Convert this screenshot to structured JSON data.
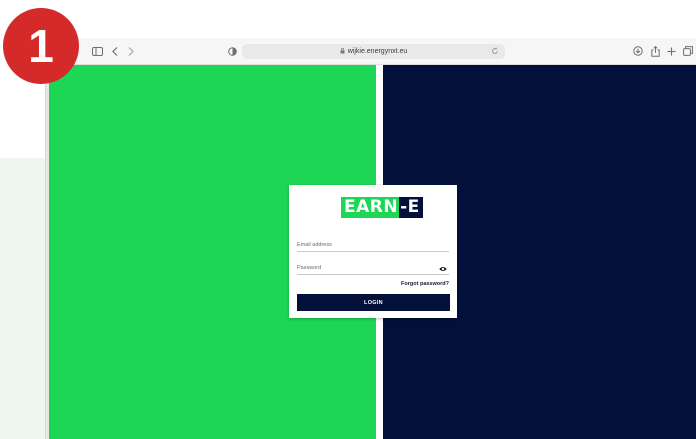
{
  "step_badge": {
    "number": "1",
    "color": "#d42a2a"
  },
  "browser": {
    "url": "wijkie.energynxt.eu",
    "toolbar_icons": [
      "sidebar-icon",
      "back-icon",
      "forward-icon",
      "privacy-shield-icon",
      "lock-icon",
      "reload-icon",
      "download-icon",
      "share-icon",
      "new-tab-icon",
      "tabs-overview-icon"
    ]
  },
  "page": {
    "left_panel_color": "#1ed655",
    "right_panel_color": "#02103a"
  },
  "login": {
    "logo_part_a": "EARN",
    "logo_part_b": "-E",
    "email_placeholder": "Email address",
    "password_placeholder": "Password",
    "forgot_label": "Forgot password?",
    "login_label": "LOGIN"
  }
}
